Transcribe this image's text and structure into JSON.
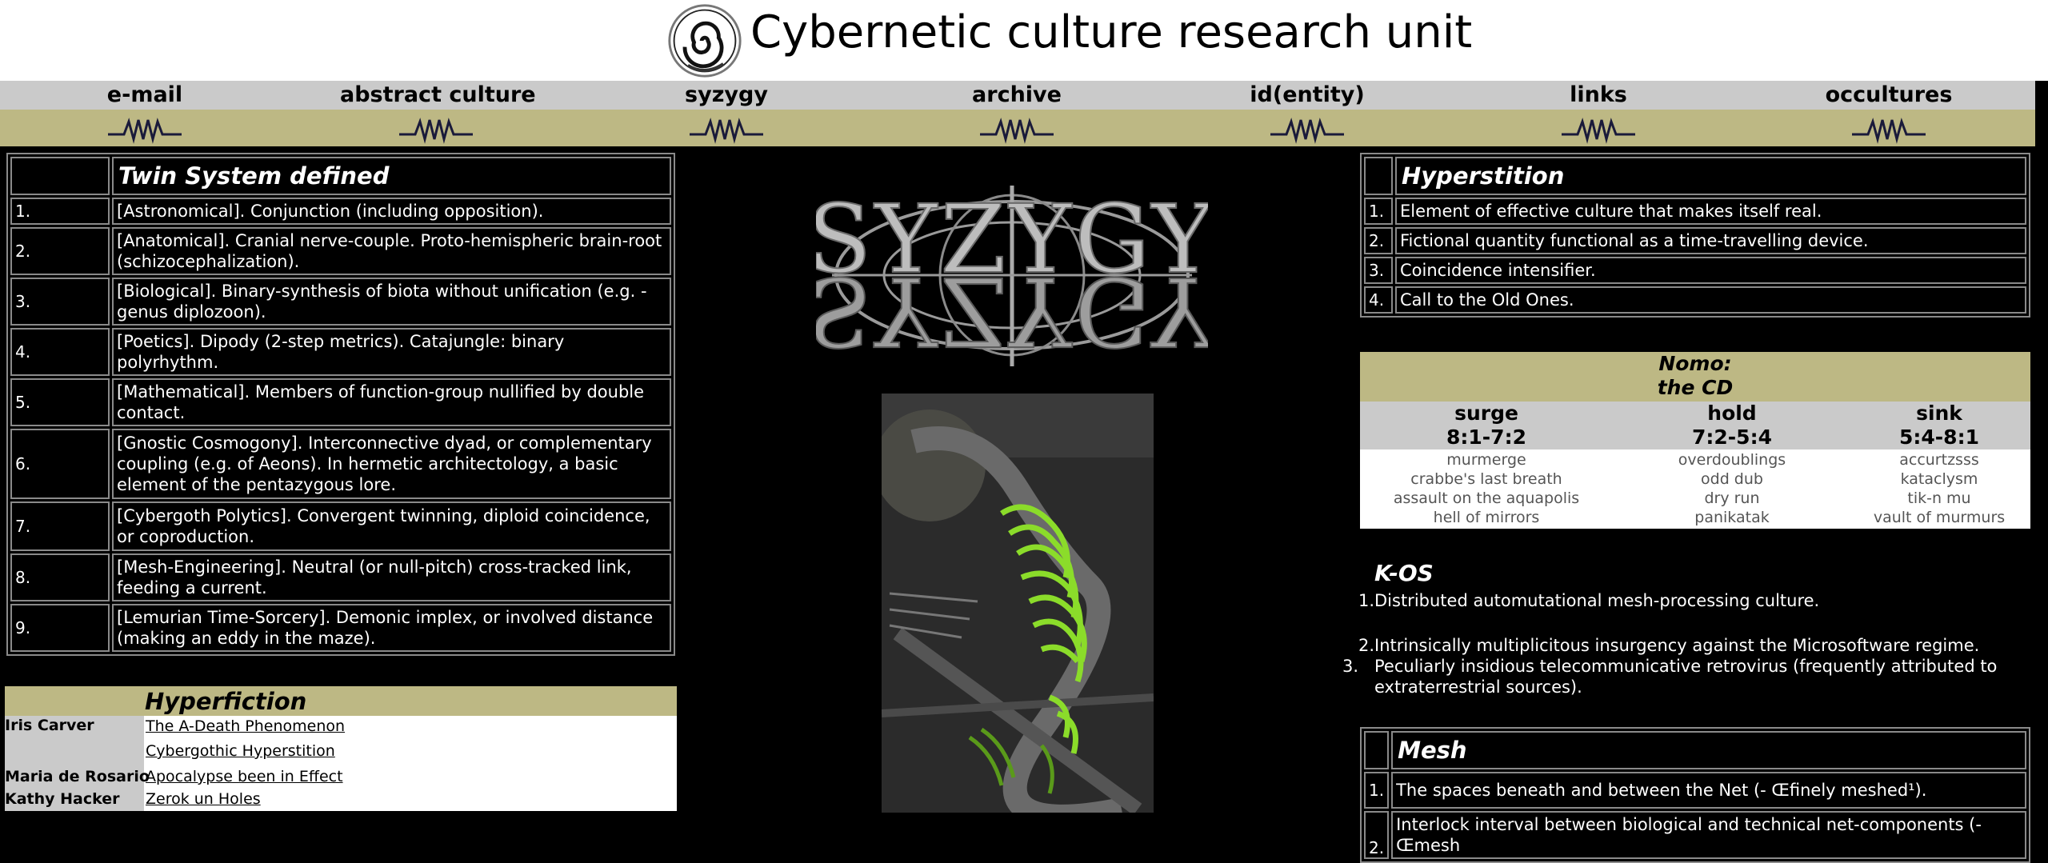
{
  "site": {
    "title": "Cybernetic culture research unit"
  },
  "nav": [
    {
      "label": "e-mail"
    },
    {
      "label": "abstract culture"
    },
    {
      "label": "syzygy"
    },
    {
      "label": "archive"
    },
    {
      "label": "id(entity)"
    },
    {
      "label": "links"
    },
    {
      "label": "occultures"
    }
  ],
  "twin_system": {
    "title": "Twin System defined",
    "items": [
      {
        "n": "1.",
        "text": "[Astronomical]. Conjunction (including opposition)."
      },
      {
        "n": "2.",
        "text": "[Anatomical]. Cranial nerve-couple. Proto-hemispheric brain-root (schizocephalization)."
      },
      {
        "n": "3.",
        "text": "[Biological]. Binary-synthesis of biota without unification (e.g. - genus diplozoon)."
      },
      {
        "n": "4.",
        "text": "[Poetics]. Dipody (2-step metrics). Catajungle: binary polyrhythm."
      },
      {
        "n": "5.",
        "text": "[Mathematical]. Members of function-group nullified by double contact."
      },
      {
        "n": "6.",
        "text": "[Gnostic Cosmogony]. Interconnective dyad, or complementary coupling (e.g. of Aeons). In hermetic architectology, a basic element of the pentazygous lore."
      },
      {
        "n": "7.",
        "text": "[Cybergoth Polytics]. Convergent twinning, diploid coincidence, or coproduction."
      },
      {
        "n": "8.",
        "text": "[Mesh-Engineering]. Neutral (or null-pitch) cross-tracked link, feeding a current."
      },
      {
        "n": "9.",
        "text": "[Lemurian Time-Sorcery]. Demonic implex, or involved distance (making an eddy in the maze)."
      }
    ]
  },
  "hyperfiction": {
    "title": "Hyperfiction",
    "entries": [
      {
        "author": "Iris Carver",
        "link": "The A-Death Phenomenon"
      },
      {
        "author": "",
        "link": "Cybergothic Hyperstition"
      },
      {
        "author": "Maria de Rosario",
        "link": "Apocalypse been in Effect"
      },
      {
        "author": "Kathy Hacker",
        "link": "Zerok un Holes"
      }
    ]
  },
  "syzygy_logo": {
    "text": "SYZYGY"
  },
  "hyperstition": {
    "title": "Hyperstition",
    "items": [
      {
        "n": "1.",
        "text": "Element of effective culture that makes itself real."
      },
      {
        "n": "2.",
        "text": "Fictional quantity functional as a time-travelling device."
      },
      {
        "n": "3.",
        "text": "Coincidence intensifier."
      },
      {
        "n": "4.",
        "text": "Call to the Old Ones."
      }
    ]
  },
  "nomo": {
    "title_line1": "Nomo:",
    "title_line2": "the CD",
    "columns": [
      {
        "name": "surge",
        "range": "8:1-7:2",
        "tracks": [
          "murmerge",
          "crabbe's last breath",
          "assault on the aquapolis",
          "hell of mirrors"
        ]
      },
      {
        "name": "hold",
        "range": "7:2-5:4",
        "tracks": [
          "overdoublings",
          "odd dub",
          "dry run",
          "panikatak"
        ]
      },
      {
        "name": "sink",
        "range": "5:4-8:1",
        "tracks": [
          "accurtzsss",
          "kataclysm",
          "tik-n mu",
          "vault of murmurs"
        ]
      }
    ]
  },
  "kos": {
    "title": "K-OS",
    "items": [
      {
        "n": "1.",
        "text": "Distributed automutational mesh-processing culture."
      },
      {
        "n": "2.",
        "text": "Intrinsically multiplicitous insurgency against the Microsoftware regime."
      },
      {
        "n": "3.",
        "text": "Peculiarly insidious telecommunicative retrovirus (frequently attributed to extraterrestrial sources)."
      }
    ]
  },
  "mesh": {
    "title": "Mesh",
    "items": [
      {
        "n": "1.",
        "text": "The spaces beneath and between the Net (- Œfinely meshed¹)."
      },
      {
        "n": "2.",
        "text": "Interlock interval between biological and technical net-components (- Œmesh"
      }
    ]
  },
  "icons": {
    "logo": "spiral-logo",
    "nav_decoration": "squiggle-icon"
  },
  "colors": {
    "page_bg": "#000000",
    "header_bg": "#ffffff",
    "nav_bg": "#cacaca",
    "accent_olive": "#bdb884",
    "table_border": "#8a8a8a",
    "collage_green": "#8bdc2a"
  }
}
